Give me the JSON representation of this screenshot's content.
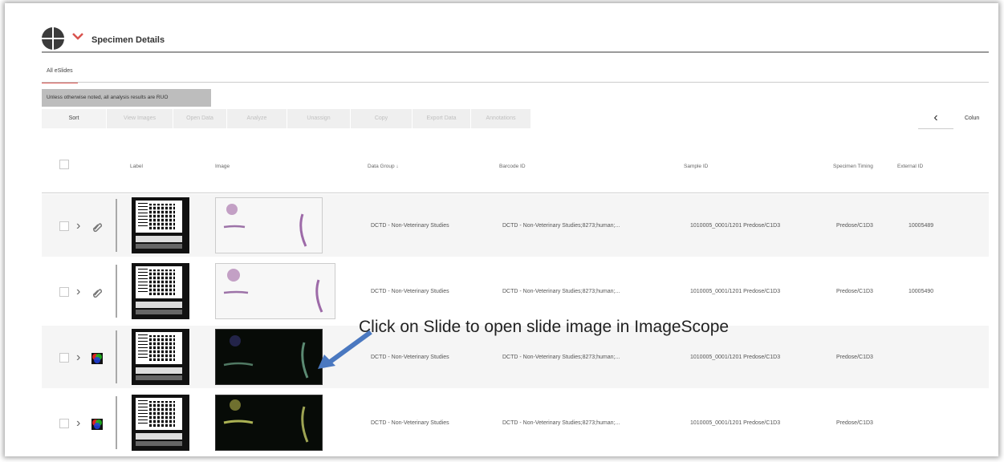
{
  "header": {
    "title": "Specimen Details"
  },
  "tabs": [
    {
      "label": "All eSlides"
    }
  ],
  "notice": "Unless otherwise noted, all analysis results are RUO",
  "toolbar": {
    "buttons": [
      {
        "label": "Sort",
        "enabled": true
      },
      {
        "label": "View Images",
        "enabled": false
      },
      {
        "label": "Open Data",
        "enabled": false
      },
      {
        "label": "Analyze",
        "enabled": false
      },
      {
        "label": "Unassign",
        "enabled": false
      },
      {
        "label": "Copy",
        "enabled": false
      },
      {
        "label": "Export Data",
        "enabled": false
      },
      {
        "label": "Annotations",
        "enabled": false
      }
    ],
    "back_icon": "‹",
    "columns_label": "Colun"
  },
  "table": {
    "columns": [
      "Label",
      "Image",
      "Data Group ↓",
      "Barcode ID",
      "Sample ID",
      "Specimen Timing",
      "External ID"
    ],
    "rows": [
      {
        "type_icon": "paperclip-icon",
        "data_group": "DCTD - Non-Veterinary Studies",
        "barcode_id": "DCTD - Non-Veterinary Studies;8273;human;...",
        "sample_id": "1010005_0001/1201 Predose/C1D3",
        "specimen_timing": "Predose/C1D3",
        "external_id": "10005489",
        "slide_style": "light"
      },
      {
        "type_icon": "paperclip-icon",
        "data_group": "DCTD - Non-Veterinary Studies",
        "barcode_id": "DCTD - Non-Veterinary Studies;8273;human;...",
        "sample_id": "1010005_0001/1201 Predose/C1D3",
        "specimen_timing": "Predose/C1D3",
        "external_id": "10005490",
        "slide_style": "light"
      },
      {
        "type_icon": "rgb-image-icon",
        "data_group": "DCTD - Non-Veterinary Studies",
        "barcode_id": "DCTD - Non-Veterinary Studies;8273;human;...",
        "sample_id": "1010005_0001/1201 Predose/C1D3",
        "specimen_timing": "Predose/C1D3",
        "external_id": "",
        "slide_style": "dark"
      },
      {
        "type_icon": "rgb-image-icon",
        "data_group": "DCTD - Non-Veterinary Studies",
        "barcode_id": "DCTD - Non-Veterinary Studies;8273;human;...",
        "sample_id": "1010005_0001/1201 Predose/C1D3",
        "specimen_timing": "Predose/C1D3",
        "external_id": "",
        "slide_style": "dark"
      }
    ]
  },
  "callout": {
    "text": "Click on Slide to open slide image in ImageScope",
    "arrow_color": "#4a78c0"
  },
  "colors": {
    "accent": "#d9534f",
    "row_alt": "#f5f5f5",
    "notice_bg": "#bdbdbd"
  }
}
